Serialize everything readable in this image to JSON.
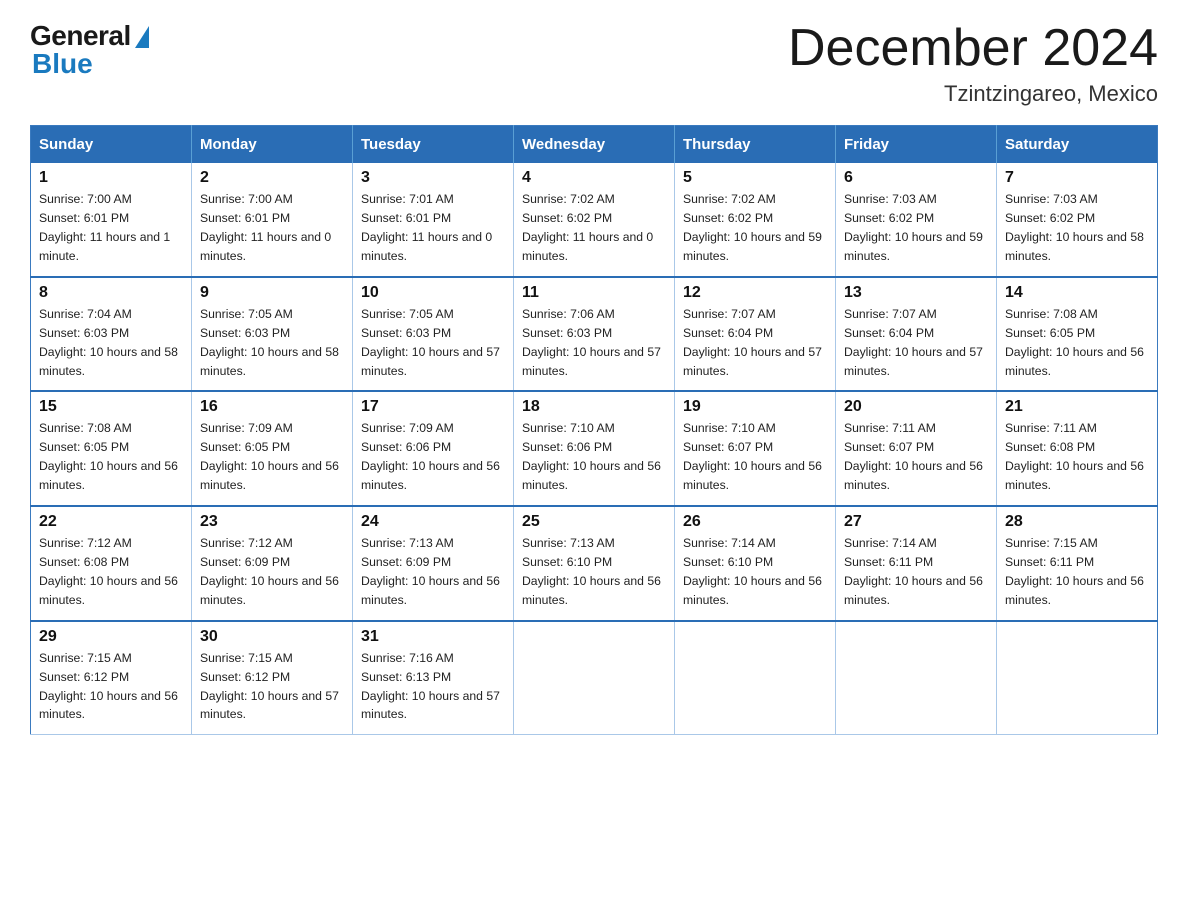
{
  "logo": {
    "general": "General",
    "blue": "Blue"
  },
  "title": "December 2024",
  "location": "Tzintzingareo, Mexico",
  "days_of_week": [
    "Sunday",
    "Monday",
    "Tuesday",
    "Wednesday",
    "Thursday",
    "Friday",
    "Saturday"
  ],
  "weeks": [
    [
      {
        "day": "1",
        "sunrise": "7:00 AM",
        "sunset": "6:01 PM",
        "daylight": "11 hours and 1 minute."
      },
      {
        "day": "2",
        "sunrise": "7:00 AM",
        "sunset": "6:01 PM",
        "daylight": "11 hours and 0 minutes."
      },
      {
        "day": "3",
        "sunrise": "7:01 AM",
        "sunset": "6:01 PM",
        "daylight": "11 hours and 0 minutes."
      },
      {
        "day": "4",
        "sunrise": "7:02 AM",
        "sunset": "6:02 PM",
        "daylight": "11 hours and 0 minutes."
      },
      {
        "day": "5",
        "sunrise": "7:02 AM",
        "sunset": "6:02 PM",
        "daylight": "10 hours and 59 minutes."
      },
      {
        "day": "6",
        "sunrise": "7:03 AM",
        "sunset": "6:02 PM",
        "daylight": "10 hours and 59 minutes."
      },
      {
        "day": "7",
        "sunrise": "7:03 AM",
        "sunset": "6:02 PM",
        "daylight": "10 hours and 58 minutes."
      }
    ],
    [
      {
        "day": "8",
        "sunrise": "7:04 AM",
        "sunset": "6:03 PM",
        "daylight": "10 hours and 58 minutes."
      },
      {
        "day": "9",
        "sunrise": "7:05 AM",
        "sunset": "6:03 PM",
        "daylight": "10 hours and 58 minutes."
      },
      {
        "day": "10",
        "sunrise": "7:05 AM",
        "sunset": "6:03 PM",
        "daylight": "10 hours and 57 minutes."
      },
      {
        "day": "11",
        "sunrise": "7:06 AM",
        "sunset": "6:03 PM",
        "daylight": "10 hours and 57 minutes."
      },
      {
        "day": "12",
        "sunrise": "7:07 AM",
        "sunset": "6:04 PM",
        "daylight": "10 hours and 57 minutes."
      },
      {
        "day": "13",
        "sunrise": "7:07 AM",
        "sunset": "6:04 PM",
        "daylight": "10 hours and 57 minutes."
      },
      {
        "day": "14",
        "sunrise": "7:08 AM",
        "sunset": "6:05 PM",
        "daylight": "10 hours and 56 minutes."
      }
    ],
    [
      {
        "day": "15",
        "sunrise": "7:08 AM",
        "sunset": "6:05 PM",
        "daylight": "10 hours and 56 minutes."
      },
      {
        "day": "16",
        "sunrise": "7:09 AM",
        "sunset": "6:05 PM",
        "daylight": "10 hours and 56 minutes."
      },
      {
        "day": "17",
        "sunrise": "7:09 AM",
        "sunset": "6:06 PM",
        "daylight": "10 hours and 56 minutes."
      },
      {
        "day": "18",
        "sunrise": "7:10 AM",
        "sunset": "6:06 PM",
        "daylight": "10 hours and 56 minutes."
      },
      {
        "day": "19",
        "sunrise": "7:10 AM",
        "sunset": "6:07 PM",
        "daylight": "10 hours and 56 minutes."
      },
      {
        "day": "20",
        "sunrise": "7:11 AM",
        "sunset": "6:07 PM",
        "daylight": "10 hours and 56 minutes."
      },
      {
        "day": "21",
        "sunrise": "7:11 AM",
        "sunset": "6:08 PM",
        "daylight": "10 hours and 56 minutes."
      }
    ],
    [
      {
        "day": "22",
        "sunrise": "7:12 AM",
        "sunset": "6:08 PM",
        "daylight": "10 hours and 56 minutes."
      },
      {
        "day": "23",
        "sunrise": "7:12 AM",
        "sunset": "6:09 PM",
        "daylight": "10 hours and 56 minutes."
      },
      {
        "day": "24",
        "sunrise": "7:13 AM",
        "sunset": "6:09 PM",
        "daylight": "10 hours and 56 minutes."
      },
      {
        "day": "25",
        "sunrise": "7:13 AM",
        "sunset": "6:10 PM",
        "daylight": "10 hours and 56 minutes."
      },
      {
        "day": "26",
        "sunrise": "7:14 AM",
        "sunset": "6:10 PM",
        "daylight": "10 hours and 56 minutes."
      },
      {
        "day": "27",
        "sunrise": "7:14 AM",
        "sunset": "6:11 PM",
        "daylight": "10 hours and 56 minutes."
      },
      {
        "day": "28",
        "sunrise": "7:15 AM",
        "sunset": "6:11 PM",
        "daylight": "10 hours and 56 minutes."
      }
    ],
    [
      {
        "day": "29",
        "sunrise": "7:15 AM",
        "sunset": "6:12 PM",
        "daylight": "10 hours and 56 minutes."
      },
      {
        "day": "30",
        "sunrise": "7:15 AM",
        "sunset": "6:12 PM",
        "daylight": "10 hours and 57 minutes."
      },
      {
        "day": "31",
        "sunrise": "7:16 AM",
        "sunset": "6:13 PM",
        "daylight": "10 hours and 57 minutes."
      },
      null,
      null,
      null,
      null
    ]
  ]
}
